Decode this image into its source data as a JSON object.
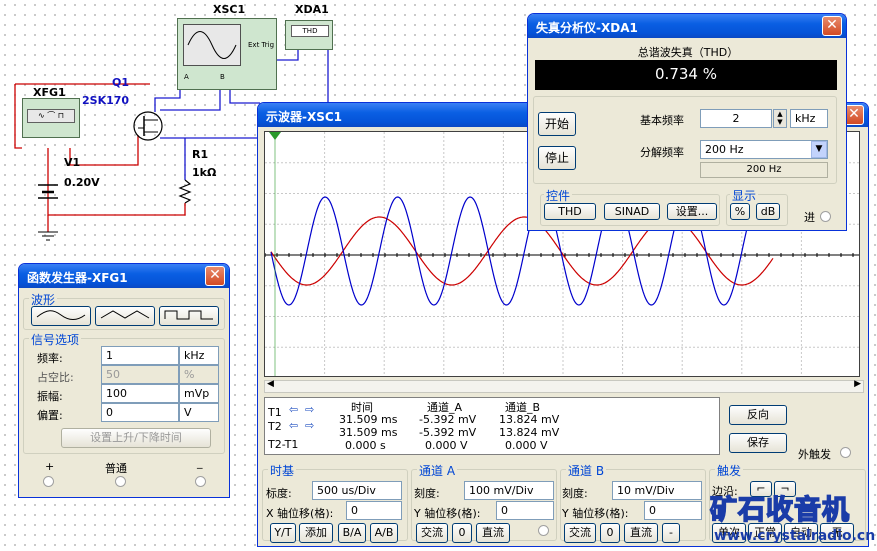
{
  "circuit": {
    "xsc1": "XSC1",
    "xda1": "XDA1",
    "xfg1": "XFG1",
    "q1": "Q1",
    "q1_part": "2SK170",
    "v1": "V1",
    "v1_value": "0.20V",
    "r1": "R1",
    "r1_value": "1kΩ",
    "thd_label": "THD",
    "ext_trig": "Ext Trig",
    "pin_a": "A",
    "pin_b": "B"
  },
  "dist": {
    "title": "失真分析仪-XDA1",
    "thd_heading": "总谐波失真（THD）",
    "reading": "0.734 %",
    "start_btn": "开始",
    "stop_btn": "停止",
    "fund_label": "基本频率",
    "fund_value": "2",
    "fund_unit": "kHz",
    "res_label": "分解频率",
    "res_value": "200 Hz",
    "res_note": "200 Hz",
    "controls_title": "控件",
    "thd_btn": "THD",
    "sinad_btn": "SINAD",
    "settings_btn": "设置...",
    "display_title": "显示",
    "pct_btn": "%",
    "db_btn": "dB",
    "input_label": "进"
  },
  "func": {
    "title": "函数发生器-XFG1",
    "waveform_title": "波形",
    "options_title": "信号选项",
    "rows": [
      {
        "label": "频率:",
        "value": "1",
        "unit": "kHz"
      },
      {
        "label": "占空比:",
        "value": "50",
        "unit": "%"
      },
      {
        "label": "振幅:",
        "value": "100",
        "unit": "mVp"
      },
      {
        "label": "偏置:",
        "value": "0",
        "unit": "V"
      }
    ],
    "rise_btn": "设置上升/下降时间",
    "plus": "+",
    "common": "普通",
    "minus": "_"
  },
  "scope": {
    "title": "示波器-XSC1",
    "readout": {
      "headers": [
        "时间",
        "通道_A",
        "通道_B"
      ],
      "rows": [
        {
          "label": "T1",
          "time": "31.509 ms",
          "a": "-5.392 mV",
          "b": "13.824 mV"
        },
        {
          "label": "T2",
          "time": "31.509 ms",
          "a": "-5.392 mV",
          "b": "13.824 mV"
        },
        {
          "label": "T2-T1",
          "time": "0.000 s",
          "a": "0.000 V",
          "b": "0.000 V"
        }
      ]
    },
    "reverse_btn": "反向",
    "save_btn": "保存",
    "ext_trigger": "外触发",
    "timebase": {
      "title": "时基",
      "scale_label": "标度:",
      "scale": "500 us/Div",
      "xpos_label": "X 轴位移(格):",
      "xpos": "0",
      "buttons": [
        "Y/T",
        "添加",
        "B/A",
        "A/B"
      ]
    },
    "chA": {
      "title": "通道 A",
      "scale_label": "刻度:",
      "scale": "100 mV/Div",
      "ypos_label": "Y 轴位移(格):",
      "ypos": "0",
      "buttons": [
        "交流",
        "0",
        "直流"
      ]
    },
    "chB": {
      "title": "通道 B",
      "scale_label": "刻度:",
      "scale": "10 mV/Div",
      "ypos_label": "Y 轴位移(格):",
      "ypos": "0",
      "buttons": [
        "交流",
        "0",
        "直流",
        "-"
      ]
    },
    "trigger": {
      "title": "触发",
      "edge_label": "边沿:",
      "buttons": [
        "单次",
        "正常",
        "自动",
        "无"
      ]
    }
  },
  "watermark": {
    "text": "矿石收音机",
    "url": "www.crystalradio.cn"
  },
  "colors": {
    "channel_a": "#cc0000",
    "channel_b": "#0000cc",
    "wire": "#1a1ad0",
    "wire_red": "#cc0000"
  }
}
